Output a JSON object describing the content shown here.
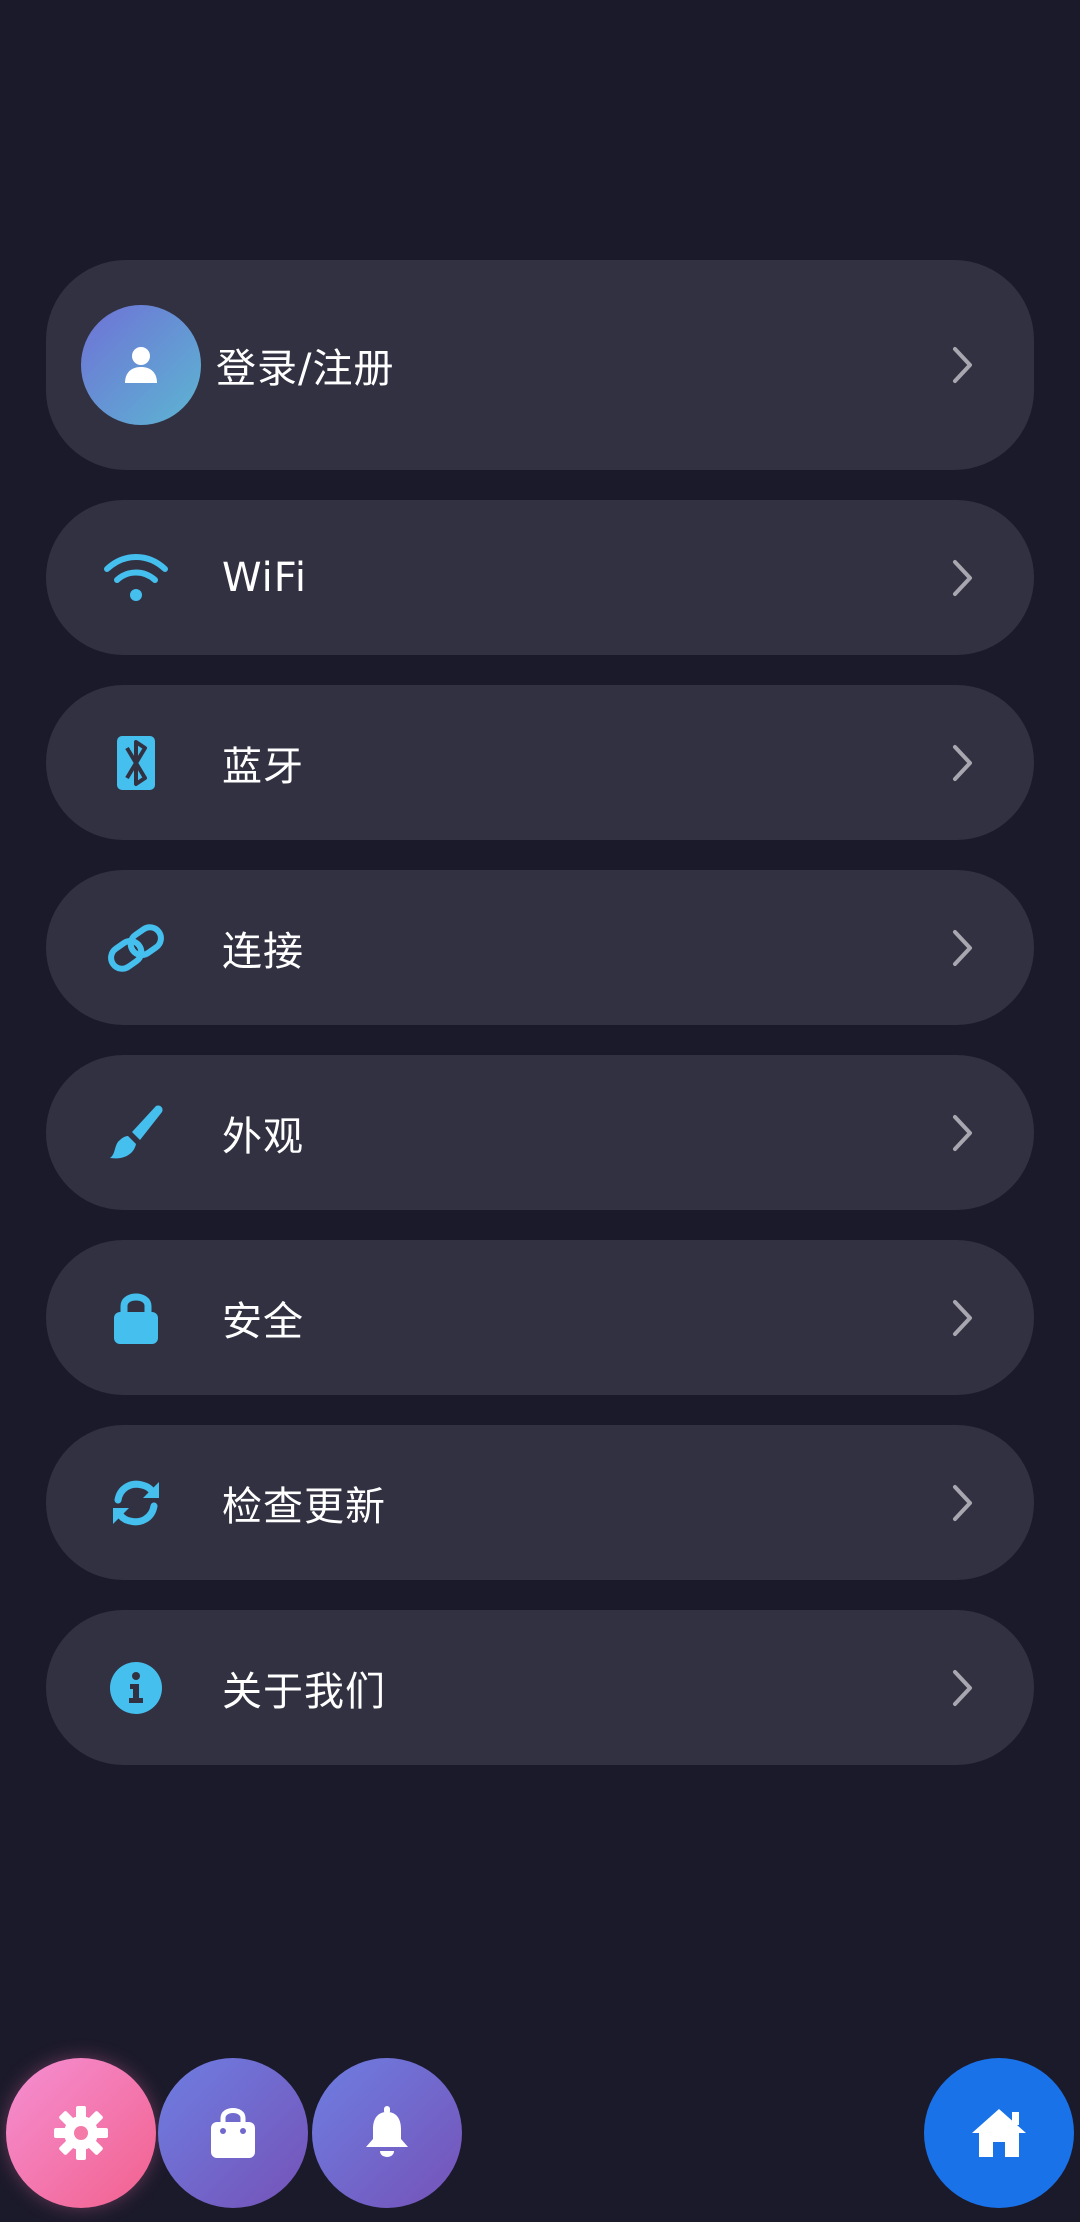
{
  "theme": {
    "background": "#1b1a2b",
    "card": "#323142",
    "icon_accent": "#45bfee",
    "text": "#ffffff",
    "chevron": "#a8a7b0"
  },
  "account": {
    "label": "登录/注册",
    "avatar_icon": "person-icon"
  },
  "menu": [
    {
      "label": "WiFi",
      "icon": "wifi-icon"
    },
    {
      "label": "蓝牙",
      "icon": "bluetooth-icon"
    },
    {
      "label": "连接",
      "icon": "link-icon"
    },
    {
      "label": "外观",
      "icon": "paintbrush-icon"
    },
    {
      "label": "安全",
      "icon": "lock-icon"
    },
    {
      "label": "检查更新",
      "icon": "refresh-icon"
    },
    {
      "label": "关于我们",
      "icon": "info-icon"
    }
  ],
  "bottom_nav": [
    {
      "name": "settings",
      "icon": "gear-icon",
      "color": "#f2618d"
    },
    {
      "name": "shop",
      "icon": "shopping-bag-icon",
      "color": "#6e7ee2"
    },
    {
      "name": "notifications",
      "icon": "bell-icon",
      "color": "#6e7ee2"
    },
    {
      "name": "home",
      "icon": "home-icon",
      "color": "#1a72e8"
    }
  ]
}
